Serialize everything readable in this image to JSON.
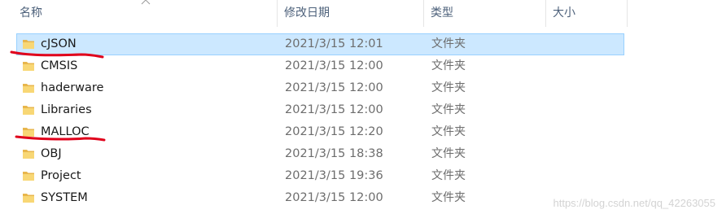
{
  "columns": {
    "name": "名称",
    "date": "修改日期",
    "type": "类型",
    "size": "大小"
  },
  "rows": [
    {
      "name": "cJSON",
      "date": "2021/3/15 12:01",
      "type": "文件夹",
      "size": "",
      "selected": true
    },
    {
      "name": "CMSIS",
      "date": "2021/3/15 12:00",
      "type": "文件夹",
      "size": ""
    },
    {
      "name": "haderware",
      "date": "2021/3/15 12:00",
      "type": "文件夹",
      "size": ""
    },
    {
      "name": "Libraries",
      "date": "2021/3/15 12:00",
      "type": "文件夹",
      "size": ""
    },
    {
      "name": "MALLOC",
      "date": "2021/3/15 12:20",
      "type": "文件夹",
      "size": ""
    },
    {
      "name": "OBJ",
      "date": "2021/3/15 18:38",
      "type": "文件夹",
      "size": ""
    },
    {
      "name": "Project",
      "date": "2021/3/15 19:36",
      "type": "文件夹",
      "size": ""
    },
    {
      "name": "SYSTEM",
      "date": "2021/3/15 12:00",
      "type": "文件夹",
      "size": ""
    }
  ],
  "watermark": "https://blog.csdn.net/qq_42263055",
  "colors": {
    "selection_bg": "#cce8ff",
    "selection_border": "#99d1ff",
    "folder": "#f8d775",
    "annotation": "#e0001b"
  },
  "icons": {
    "sort": "chevron-up-icon",
    "folder": "folder-icon"
  }
}
